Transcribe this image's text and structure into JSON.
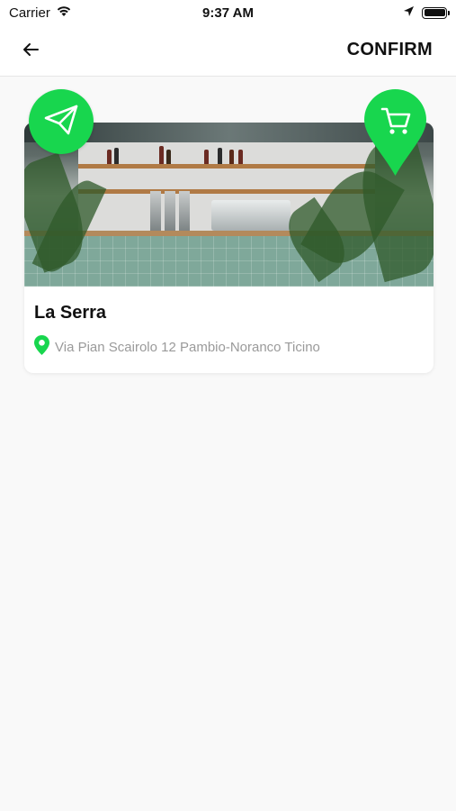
{
  "status_bar": {
    "carrier": "Carrier",
    "time": "9:37 AM"
  },
  "nav": {
    "back_icon": "arrow-left-icon",
    "confirm_label": "CONFIRM"
  },
  "venue_card": {
    "name": "La Serra",
    "address": "Via Pian Scairolo 12 Pambio-Noranco Ticino",
    "location_icon": "map-pin-icon"
  },
  "actions": {
    "send_icon": "paper-plane-icon",
    "cart_icon": "shopping-cart-pin-icon"
  },
  "colors": {
    "accent_green": "#18d64e",
    "background": "#f9f9f9",
    "address_gray": "#9a9a9a"
  }
}
